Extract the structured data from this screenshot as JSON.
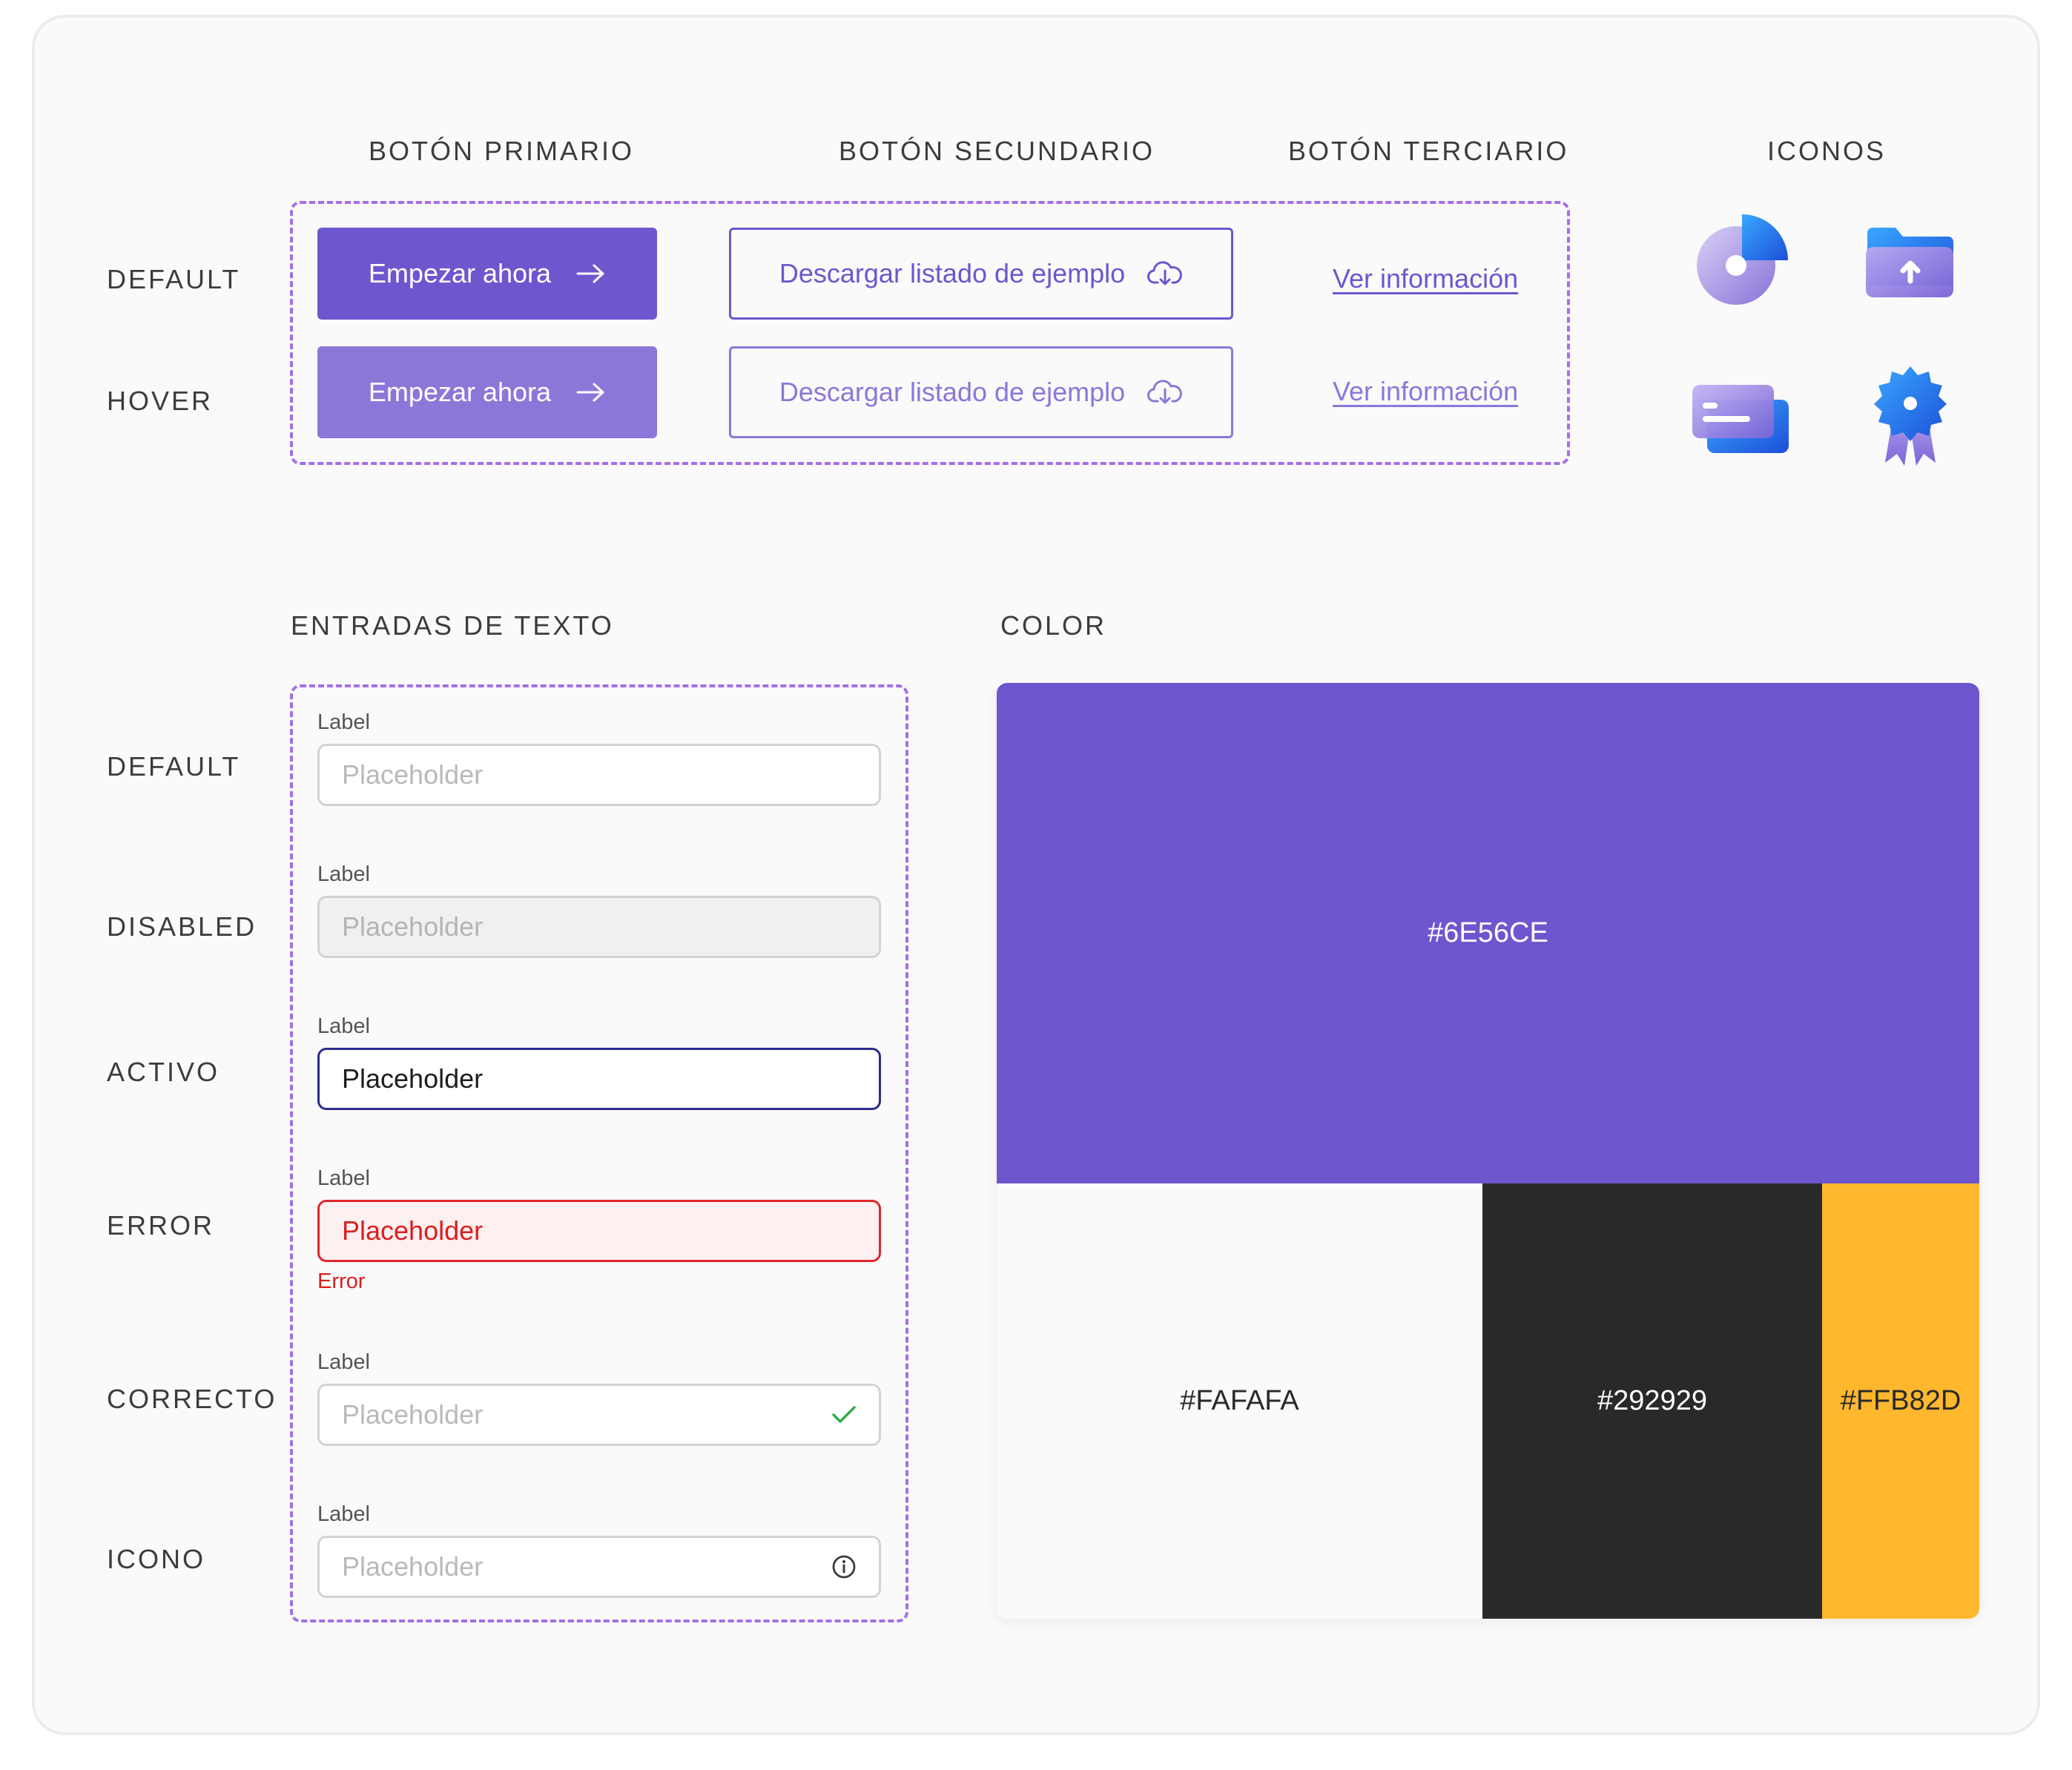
{
  "headers": {
    "primary": "BOTÓN PRIMARIO",
    "secondary": "BOTÓN SECUNDARIO",
    "tertiary": "BOTÓN TERCIARIO",
    "icons": "ICONOS",
    "inputs": "ENTRADAS DE TEXTO",
    "color": "COLOR"
  },
  "button_rows": {
    "default": "DEFAULT",
    "hover": "HOVER"
  },
  "buttons": {
    "primary_label": "Empezar ahora",
    "secondary_label": "Descargar listado de ejemplo",
    "tertiary_label": "Ver información"
  },
  "input_rows": {
    "default": "DEFAULT",
    "disabled": "DISABLED",
    "active": "ACTIVO",
    "error": "ERROR",
    "correct": "CORRECTO",
    "icon": "ICONO"
  },
  "inputs": {
    "label": "Label",
    "placeholder": "Placeholder",
    "error_message": "Error"
  },
  "colors": {
    "primary": "#6E56CE",
    "light": "#FAFAFA",
    "dark": "#292929",
    "accent": "#FFB82D"
  },
  "icon_names": [
    "pie-chart-icon",
    "folder-upload-icon",
    "cards-icon",
    "award-badge-icon"
  ]
}
